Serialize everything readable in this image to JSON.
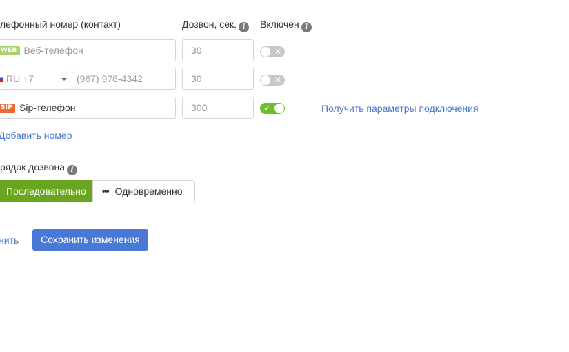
{
  "headers": {
    "phone": "лефонный номер (контакт)",
    "ring": "Дозвон, сек.",
    "enabled": "Включен",
    "info_glyph": "i"
  },
  "rows": [
    {
      "tag": "WEB",
      "value": "Веб-телефон",
      "seconds": "30",
      "enabled": false,
      "toggle_mark": "✕"
    },
    {
      "country": "RU +7",
      "placeholder": "(967) 978-4342",
      "seconds": "30",
      "enabled": false,
      "toggle_mark": "✕"
    },
    {
      "tag": "SIP",
      "value": "Sip-телефон",
      "seconds": "300",
      "enabled": true,
      "toggle_mark": "✓",
      "link": "Получить параметры подключения"
    }
  ],
  "add_number": "Добавить номер",
  "order": {
    "label": "рядок дозвона",
    "options": [
      "Последовательно",
      "Одновременно"
    ],
    "selected": "Последовательно",
    "dots": "•••"
  },
  "footer": {
    "cancel": "нить",
    "save": "Сохранить изменения"
  },
  "colors": {
    "accent_green": "#6aa51f",
    "toggle_on": "#6fbf2a",
    "link_blue": "#4a78d0",
    "button_blue": "#4a78d6",
    "web_tag": "#a7d16c",
    "sip_tag": "#f06b2b"
  }
}
